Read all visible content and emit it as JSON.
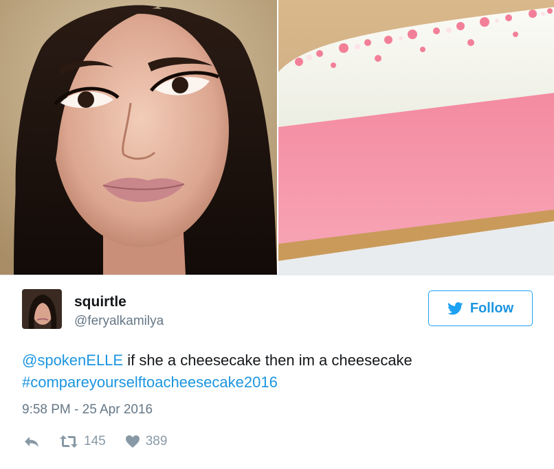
{
  "tweet": {
    "display_name": "squirtle",
    "handle": "@feryalkamilya",
    "follow_label": "Follow",
    "mention": "@spokenELLE",
    "body_text": " if she a cheesecake then im a cheesecake",
    "hashtag": "#compareyourselftoacheesecake2016",
    "timestamp": "9:58 PM - 25 Apr 2016",
    "retweet_count": "145",
    "like_count": "389"
  },
  "icons": {
    "follow": "twitter-bird-icon",
    "reply": "reply-icon",
    "retweet": "retweet-icon",
    "like": "heart-icon"
  },
  "colors": {
    "link_blue": "#1b95e0",
    "follow_border": "#1da1f2",
    "muted_gray": "#657786",
    "icon_gray": "#8899a6",
    "cake_pink": "#f39aab"
  }
}
